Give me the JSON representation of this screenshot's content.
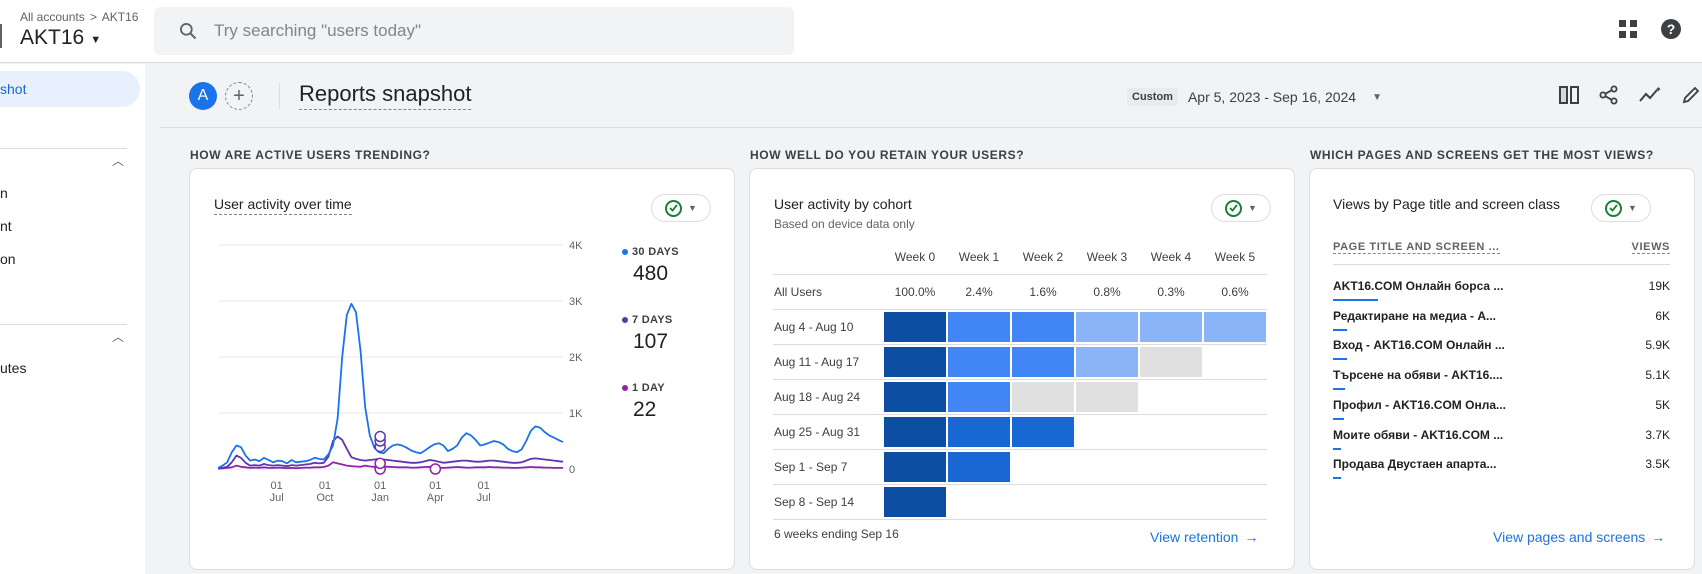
{
  "topbar": {
    "breadcrumb_all": "All accounts",
    "breadcrumb_sep": ">",
    "breadcrumb_acct": "AKT16",
    "account_name": "AKT16",
    "search_placeholder": "Try searching \"users today\""
  },
  "sidebar": {
    "active_item": "shot",
    "items": [
      "n",
      "nt",
      "on",
      "utes"
    ]
  },
  "header": {
    "avatar_letter": "A",
    "title": "Reports snapshot",
    "range_chip": "Custom",
    "date_range": "Apr 5, 2023 - Sep 16, 2024"
  },
  "sections": {
    "active_users": "HOW ARE ACTIVE USERS TRENDING?",
    "retain": "HOW WELL DO YOU RETAIN YOUR USERS?",
    "pages": "WHICH PAGES AND SCREENS GET THE MOST VIEWS?"
  },
  "activity_card": {
    "title": "User activity over time",
    "legend": [
      {
        "label": "30 DAYS",
        "value": "480",
        "color": "#1a73e8"
      },
      {
        "label": "7 DAYS",
        "value": "107",
        "color": "#5e35b1"
      },
      {
        "label": "1 DAY",
        "value": "22",
        "color": "#8e24aa"
      }
    ]
  },
  "chart_data": {
    "type": "line",
    "title": "User activity over time",
    "y_ticks": [
      "4K",
      "3K",
      "2K",
      "1K",
      "0"
    ],
    "ylim": [
      0,
      4000
    ],
    "x_ticks": [
      {
        "day": "01",
        "month": "Jul"
      },
      {
        "day": "01",
        "month": "Oct"
      },
      {
        "day": "01",
        "month": "Jan"
      },
      {
        "day": "01",
        "month": "Apr"
      },
      {
        "day": "01",
        "month": "Jul"
      }
    ],
    "grid": true,
    "series": [
      {
        "name": "30 DAYS",
        "color": "#1a73e8",
        "values": [
          20,
          60,
          120,
          300,
          420,
          390,
          240,
          150,
          170,
          140,
          200,
          160,
          120,
          150,
          140,
          100,
          160,
          120,
          130,
          140,
          160,
          200,
          180,
          170,
          260,
          420,
          900,
          2000,
          2750,
          2950,
          2800,
          2100,
          1100,
          600,
          380,
          300,
          280,
          360,
          420,
          440,
          420,
          380,
          330,
          300,
          280,
          330,
          390,
          440,
          460,
          420,
          320,
          360,
          420,
          560,
          640,
          600,
          520,
          420,
          440,
          470,
          500,
          480,
          440,
          360,
          320,
          300,
          350,
          500,
          680,
          760,
          740,
          660,
          600,
          560,
          520,
          480
        ]
      },
      {
        "name": "7 DAYS",
        "color": "#5e35b1",
        "values": [
          10,
          20,
          40,
          120,
          240,
          200,
          110,
          60,
          70,
          60,
          90,
          70,
          60,
          70,
          60,
          50,
          70,
          60,
          70,
          80,
          90,
          110,
          100,
          110,
          220,
          500,
          580,
          520,
          360,
          210,
          180,
          160,
          150,
          160,
          170,
          180,
          170,
          160,
          150,
          140,
          130,
          120,
          110,
          110,
          120,
          140,
          160,
          150,
          130,
          110,
          120,
          130,
          140,
          150,
          150,
          140,
          130,
          130,
          140,
          150,
          150,
          140,
          130,
          120,
          110,
          110,
          120,
          150,
          180,
          190,
          180,
          170,
          160,
          150,
          140,
          130
        ]
      },
      {
        "name": "1 DAY",
        "color": "#8e24aa",
        "values": [
          5,
          10,
          20,
          30,
          60,
          40,
          30,
          20,
          25,
          20,
          30,
          20,
          20,
          25,
          20,
          15,
          20,
          15,
          20,
          25,
          25,
          30,
          30,
          35,
          60,
          120,
          100,
          80,
          60,
          50,
          45,
          40,
          60,
          45,
          40,
          50,
          45,
          40,
          35,
          30,
          30,
          30,
          25,
          25,
          30,
          35,
          40,
          30,
          25,
          20,
          25,
          30,
          35,
          30,
          25,
          25,
          30,
          30,
          30,
          35,
          30,
          30,
          25,
          25,
          20,
          20,
          25,
          30,
          35,
          30,
          30,
          25,
          25,
          20,
          20,
          20
        ]
      }
    ]
  },
  "cohort_card": {
    "title": "User activity by cohort",
    "subtitle": "Based on device data only",
    "weeks": [
      "Week 0",
      "Week 1",
      "Week 2",
      "Week 3",
      "Week 4",
      "Week 5"
    ],
    "all_users_label": "All Users",
    "all_users": [
      "100.0%",
      "2.4%",
      "1.6%",
      "0.8%",
      "0.3%",
      "0.6%"
    ],
    "rows": [
      {
        "label": "Aug 4 - Aug 10",
        "cells": [
          "#0b4ea2",
          "#4285f4",
          "#4285f4",
          "#8ab4f8",
          "#8ab4f8",
          "#8ab4f8"
        ]
      },
      {
        "label": "Aug 11 - Aug 17",
        "cells": [
          "#0b4ea2",
          "#4285f4",
          "#4285f4",
          "#8ab4f8",
          "#e0e0e0",
          ""
        ]
      },
      {
        "label": "Aug 18 - Aug 24",
        "cells": [
          "#0b4ea2",
          "#4285f4",
          "#e0e0e0",
          "#e0e0e0",
          "",
          ""
        ]
      },
      {
        "label": "Aug 25 - Aug 31",
        "cells": [
          "#0b4ea2",
          "#1967d2",
          "#1967d2",
          "",
          "",
          ""
        ]
      },
      {
        "label": "Sep 1 - Sep 7",
        "cells": [
          "#0b4ea2",
          "#1967d2",
          "",
          "",
          "",
          ""
        ]
      },
      {
        "label": "Sep 8 - Sep 14",
        "cells": [
          "#0b4ea2",
          "",
          "",
          "",
          "",
          ""
        ]
      }
    ],
    "footer": "6 weeks ending Sep 16",
    "link": "View retention"
  },
  "pages_card": {
    "title": "Views by Page title and screen class",
    "col_title": "PAGE TITLE AND SCREEN ...",
    "col_views": "VIEWS",
    "rows": [
      {
        "title": "AKT16.COM Онлайн борса ...",
        "views": "19K",
        "bar": 1.0
      },
      {
        "title": "Редактиране на медиа - А...",
        "views": "6K",
        "bar": 0.3
      },
      {
        "title": "Вход - AKT16.COM Онлайн ...",
        "views": "5.9K",
        "bar": 0.3
      },
      {
        "title": "Търсене на обяви - AKT16....",
        "views": "5.1K",
        "bar": 0.26
      },
      {
        "title": "Профил - AKT16.COM Онла...",
        "views": "5K",
        "bar": 0.25
      },
      {
        "title": "Моите обяви - AKT16.COM ...",
        "views": "3.7K",
        "bar": 0.18
      },
      {
        "title": "Продава Двустаен апарта...",
        "views": "3.5K",
        "bar": 0.17
      }
    ],
    "link": "View pages and screens"
  }
}
